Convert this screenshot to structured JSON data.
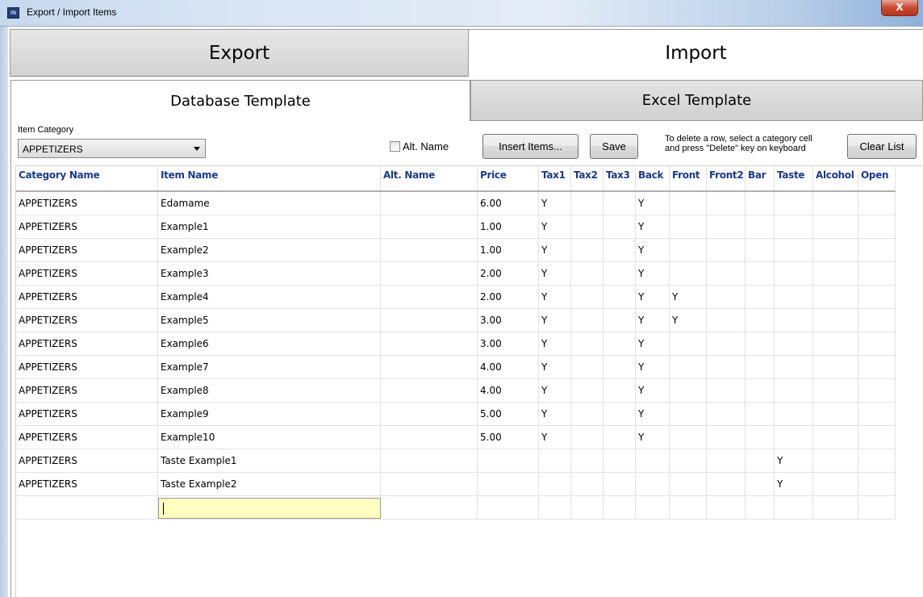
{
  "window": {
    "title": "Export / Import Items",
    "close_label": "X",
    "icon_label": "IN"
  },
  "tabs": {
    "export_label": "Export",
    "import_label": "Import"
  },
  "subtabs": {
    "database_label": "Database Template",
    "excel_label": "Excel Template"
  },
  "toolbar": {
    "category_label": "Item Category",
    "category_value": "APPETIZERS",
    "alt_name_label": "Alt. Name",
    "alt_name_checked": false,
    "insert_label": "Insert Items...",
    "save_label": "Save",
    "hint_line1": "To delete a row, select a category cell",
    "hint_line2": "and press \"Delete\" key on keyboard",
    "clear_label": "Clear List"
  },
  "grid": {
    "columns": [
      "Category Name",
      "Item Name",
      "Alt. Name",
      "Price",
      "Tax1",
      "Tax2",
      "Tax3",
      "Back",
      "Front",
      "Front2",
      "Bar",
      "Taste",
      "Alcohol",
      "Open"
    ],
    "rows": [
      [
        "APPETIZERS",
        "Edamame",
        "",
        "6.00",
        "Y",
        "",
        "",
        "Y",
        "",
        "",
        "",
        "",
        "",
        ""
      ],
      [
        "APPETIZERS",
        "Example1",
        "",
        "1.00",
        "Y",
        "",
        "",
        "Y",
        "",
        "",
        "",
        "",
        "",
        ""
      ],
      [
        "APPETIZERS",
        "Example2",
        "",
        "1.00",
        "Y",
        "",
        "",
        "Y",
        "",
        "",
        "",
        "",
        "",
        ""
      ],
      [
        "APPETIZERS",
        "Example3",
        "",
        "2.00",
        "Y",
        "",
        "",
        "Y",
        "",
        "",
        "",
        "",
        "",
        ""
      ],
      [
        "APPETIZERS",
        "Example4",
        "",
        "2.00",
        "Y",
        "",
        "",
        "Y",
        "Y",
        "",
        "",
        "",
        "",
        ""
      ],
      [
        "APPETIZERS",
        "Example5",
        "",
        "3.00",
        "Y",
        "",
        "",
        "Y",
        "Y",
        "",
        "",
        "",
        "",
        ""
      ],
      [
        "APPETIZERS",
        "Example6",
        "",
        "3.00",
        "Y",
        "",
        "",
        "Y",
        "",
        "",
        "",
        "",
        "",
        ""
      ],
      [
        "APPETIZERS",
        "Example7",
        "",
        "4.00",
        "Y",
        "",
        "",
        "Y",
        "",
        "",
        "",
        "",
        "",
        ""
      ],
      [
        "APPETIZERS",
        "Example8",
        "",
        "4.00",
        "Y",
        "",
        "",
        "Y",
        "",
        "",
        "",
        "",
        "",
        ""
      ],
      [
        "APPETIZERS",
        "Example9",
        "",
        "5.00",
        "Y",
        "",
        "",
        "Y",
        "",
        "",
        "",
        "",
        "",
        ""
      ],
      [
        "APPETIZERS",
        "Example10",
        "",
        "5.00",
        "Y",
        "",
        "",
        "Y",
        "",
        "",
        "",
        "",
        "",
        ""
      ],
      [
        "APPETIZERS",
        "Taste Example1",
        "",
        "",
        "",
        "",
        "",
        "",
        "",
        "",
        "",
        "Y",
        "",
        ""
      ],
      [
        "APPETIZERS",
        "Taste Example2",
        "",
        "",
        "",
        "",
        "",
        "",
        "",
        "",
        "",
        "Y",
        "",
        ""
      ]
    ],
    "edit_row_value": ""
  },
  "colors": {
    "header_text": "#1a3a8a",
    "edit_cell_bg": "#ffffc0",
    "close_button": "#c94a33"
  }
}
